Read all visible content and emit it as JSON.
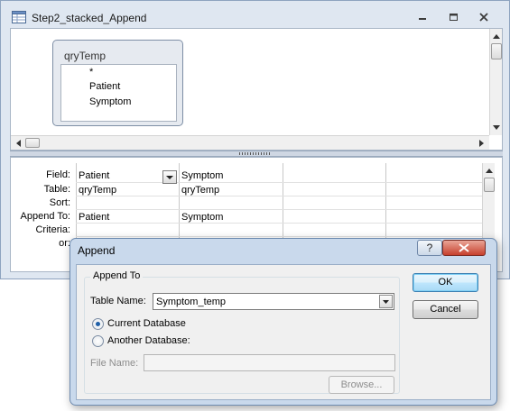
{
  "query_window": {
    "title": "Step2_stacked_Append",
    "title_icon": "query-design-icon"
  },
  "table_box": {
    "title": "qryTemp",
    "fields": [
      "*",
      "Patient",
      "Symptom"
    ]
  },
  "design_grid": {
    "row_labels": [
      "Field:",
      "Table:",
      "Sort:",
      "Append To:",
      "Criteria:",
      "or:"
    ],
    "columns": [
      {
        "field": "Patient",
        "table": "qryTemp",
        "append_to": "Patient"
      },
      {
        "field": "Symptom",
        "table": "qryTemp",
        "append_to": "Symptom"
      }
    ]
  },
  "append_dialog": {
    "title": "Append",
    "help_label": "?",
    "group_label": "Append To",
    "table_name_label": "Table Name:",
    "table_name_value": "Symptom_temp",
    "current_db_label": "Current Database",
    "current_db_selected": true,
    "another_db_label": "Another Database:",
    "another_db_selected": false,
    "file_name_label": "File Name:",
    "file_name_value": "",
    "browse_label": "Browse...",
    "ok_label": "OK",
    "cancel_label": "Cancel"
  },
  "colors": {
    "dialog_frame": "#c9d9ec",
    "close_button": "#c7402d",
    "window_frame": "#dfe7f1"
  }
}
